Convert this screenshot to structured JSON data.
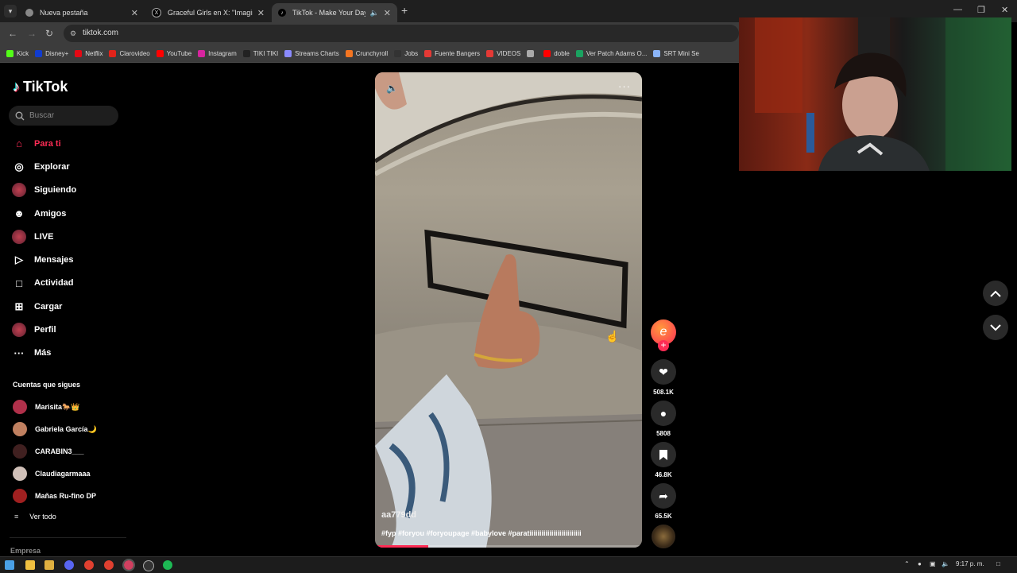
{
  "browser": {
    "tabs": [
      {
        "label": "Nueva pestaña",
        "active": false
      },
      {
        "label": "Graceful Girls en X: \"Imagine w",
        "active": false
      },
      {
        "label": "TikTok - Make Your Day",
        "active": true
      }
    ],
    "url": "tiktok.com",
    "bookmarks": [
      {
        "label": "Kick",
        "color": "#53fc18"
      },
      {
        "label": "Disney+",
        "color": "#113ccf"
      },
      {
        "label": "Netflix",
        "color": "#e50914"
      },
      {
        "label": "Clarovideo",
        "color": "#e2231a"
      },
      {
        "label": "YouTube",
        "color": "#ff0000"
      },
      {
        "label": "Instagram",
        "color": "#d6249f"
      },
      {
        "label": "TIKI TIKI",
        "color": "#222222"
      },
      {
        "label": "Streams Charts",
        "color": "#8a8aff"
      },
      {
        "label": "Crunchyroll",
        "color": "#f47521"
      },
      {
        "label": "Jobs",
        "color": "#333333"
      },
      {
        "label": "Fuente Bangers",
        "color": "#e53935"
      },
      {
        "label": "VIDEOS",
        "color": "#e53935"
      },
      {
        "label": "",
        "color": "#aaaaaa"
      },
      {
        "label": "doble",
        "color": "#ff0000"
      },
      {
        "label": "Ver Patch Adams O...",
        "color": "#1aa260"
      },
      {
        "label": "SRT Mini Se",
        "color": "#8ab4f8"
      }
    ]
  },
  "sidebar": {
    "logo": "TikTok",
    "search_placeholder": "Buscar",
    "nav": [
      {
        "label": "Para ti",
        "icon": "home-icon",
        "active": true
      },
      {
        "label": "Explorar",
        "icon": "compass-icon",
        "active": false
      },
      {
        "label": "Siguiendo",
        "icon": "avatar",
        "active": false
      },
      {
        "label": "Amigos",
        "icon": "friends-icon",
        "active": false
      },
      {
        "label": "LIVE",
        "icon": "avatar",
        "active": false
      },
      {
        "label": "Mensajes",
        "icon": "send-icon",
        "active": false
      },
      {
        "label": "Actividad",
        "icon": "activity-icon",
        "active": false
      },
      {
        "label": "Cargar",
        "icon": "upload-icon",
        "active": false
      },
      {
        "label": "Perfil",
        "icon": "avatar",
        "active": false
      },
      {
        "label": "Más",
        "icon": "more-icon",
        "active": false
      }
    ],
    "following_header": "Cuentas que sigues",
    "following": [
      {
        "name": "Marisita🐎👑",
        "color": "#b0304a"
      },
      {
        "name": "Gabriela García🌙",
        "color": "#c08060"
      },
      {
        "name": "CARABIN3___",
        "color": "#402020"
      },
      {
        "name": "Claudiagarmaaa",
        "color": "#d0c0b8"
      },
      {
        "name": "Mañas Ru-fino DP",
        "color": "#a02020"
      }
    ],
    "see_all": "Ver todo",
    "footer": "Empresa"
  },
  "video": {
    "username": "aa779dd",
    "caption": "#fyp #foryou #foryoupage #babylove #paratiiiiiiiiiiiiiiiiiiiiiiiiii",
    "progress": 0.2
  },
  "actions": {
    "likes": "508.1K",
    "comments": "5808",
    "saves": "46.8K",
    "shares": "65.5K"
  },
  "taskbar": {
    "time": "9:17 p. m."
  }
}
